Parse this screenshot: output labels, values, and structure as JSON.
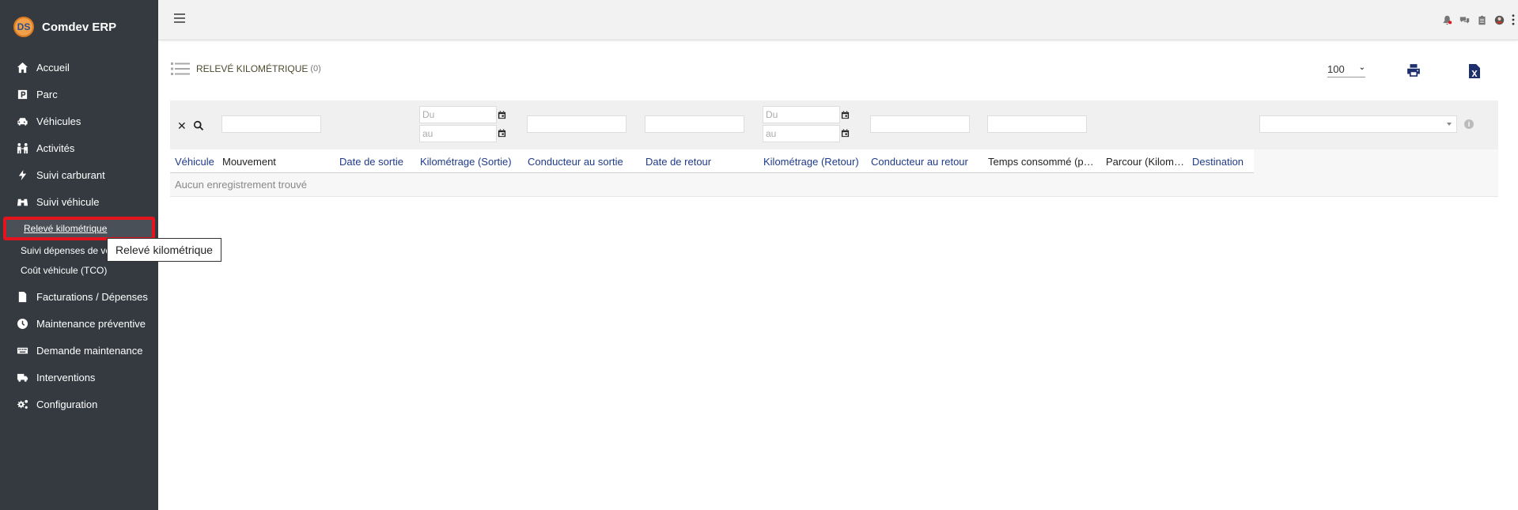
{
  "app": {
    "brand": "Comdev ERP",
    "logo_text": "DS"
  },
  "sidebar": {
    "items": [
      {
        "label": "Accueil",
        "icon": "home-icon"
      },
      {
        "label": "Parc",
        "icon": "parking-icon"
      },
      {
        "label": "Véhicules",
        "icon": "car-icon"
      },
      {
        "label": "Activités",
        "icon": "people-arrow-icon"
      },
      {
        "label": "Suivi carburant",
        "icon": "bolt-icon"
      },
      {
        "label": "Suivi véhicule",
        "icon": "binoculars-icon"
      }
    ],
    "sub_items": [
      {
        "label": "Relevé kilométrique",
        "active": true
      },
      {
        "label": "Suivi dépenses de véhicule",
        "active": false
      },
      {
        "label": "Coût véhicule (TCO)",
        "active": false
      }
    ],
    "items_after": [
      {
        "label": "Facturations / Dépenses",
        "icon": "invoice-icon"
      },
      {
        "label": "Maintenance préventive",
        "icon": "clock-icon"
      },
      {
        "label": "Demande maintenance",
        "icon": "keyboard-icon"
      },
      {
        "label": "Interventions",
        "icon": "truck-icon"
      },
      {
        "label": "Configuration",
        "icon": "cogs-icon"
      }
    ]
  },
  "tooltip": {
    "text": "Relevé kilométrique"
  },
  "page": {
    "title": "RELEVÉ KILOMÉTRIQUE",
    "count": "(0)",
    "page_size": "100"
  },
  "filters": {
    "date_from_placeholder": "Du",
    "date_to_placeholder": "au"
  },
  "table": {
    "columns": [
      {
        "label": "Véhicule",
        "sortable": true
      },
      {
        "label": "Mouvement",
        "sortable": false
      },
      {
        "label": "Date de sortie",
        "sortable": true
      },
      {
        "label": "Kilométrage (Sortie)",
        "sortable": true
      },
      {
        "label": "Conducteur au sortie",
        "sortable": true
      },
      {
        "label": "Date de retour",
        "sortable": true
      },
      {
        "label": "Kilométrage (Retour)",
        "sortable": true
      },
      {
        "label": "Conducteur au retour",
        "sortable": true
      },
      {
        "label": "Temps consommé (p…",
        "sortable": false
      },
      {
        "label": "Parcour (Kilom…",
        "sortable": false
      },
      {
        "label": "Destination",
        "sortable": true
      }
    ],
    "empty_message": "Aucun enregistrement trouvé"
  },
  "colors": {
    "sidebar_bg": "#343a40",
    "active_outline": "#e3141e",
    "link_blue": "#1e3a8a",
    "title_color": "#4d4a2f"
  }
}
